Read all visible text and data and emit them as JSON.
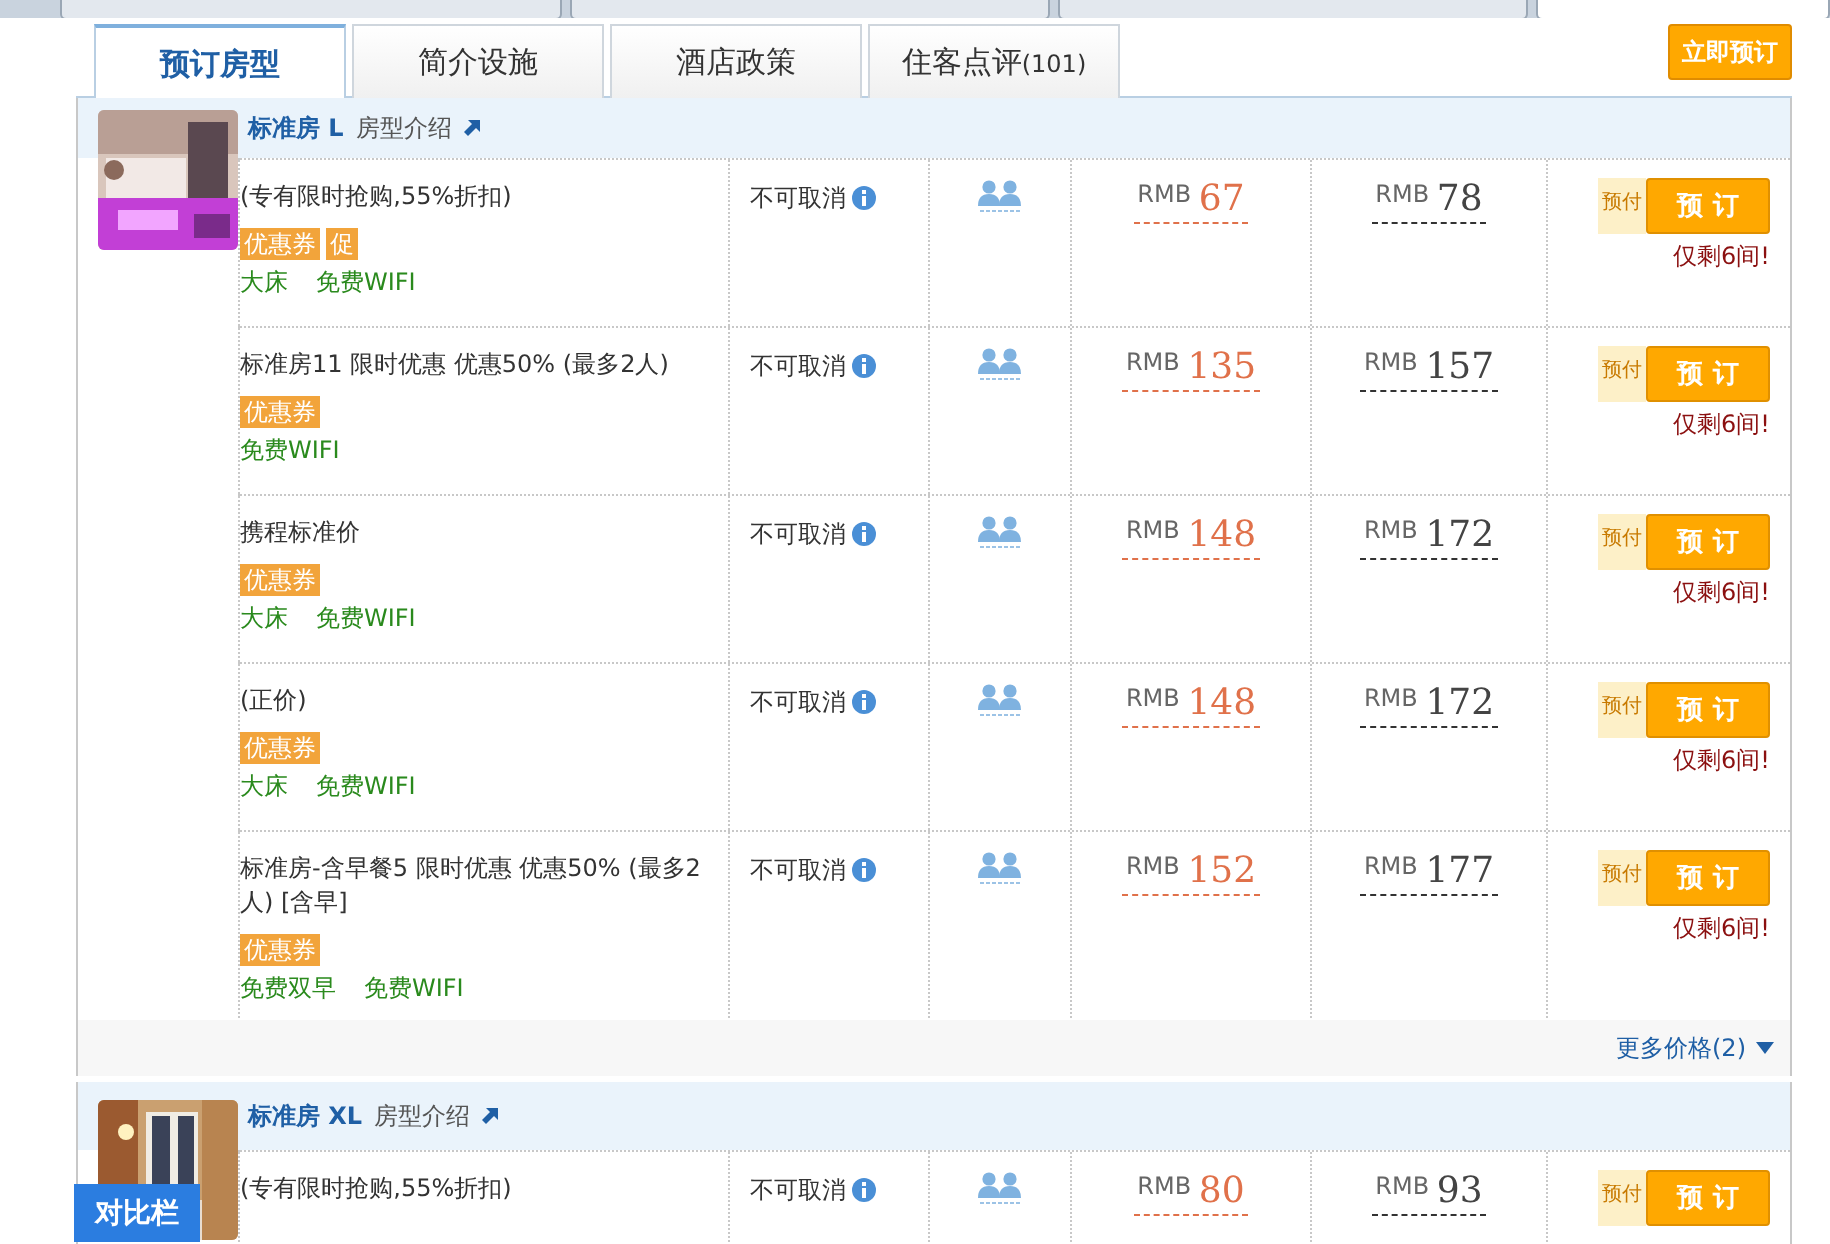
{
  "browser_tabs": [
    {
      "selected": false
    },
    {
      "selected": false
    },
    {
      "selected": false
    },
    {
      "selected": true
    }
  ],
  "tabs": [
    {
      "label": "预订房型",
      "selected": true
    },
    {
      "label": "简介设施",
      "selected": false
    },
    {
      "label": "酒店政策",
      "selected": false
    },
    {
      "label": "住客点评",
      "count": "(101)",
      "selected": false
    }
  ],
  "book_now": "立即预订",
  "rooms": [
    {
      "name": "标准房 L",
      "intro_link": "房型介绍",
      "image": {
        "kind": "picture"
      },
      "more_prices": "更多价格(2)",
      "rates": [
        {
          "description": "(专有限时抢购,55%折扣)",
          "tags": [
            "优惠券",
            "促"
          ],
          "features": [
            "大床",
            "免费WIFI"
          ],
          "cancel_policy": "不可取消",
          "price": {
            "currency": "RMB",
            "amount": "67"
          },
          "original_price": {
            "currency": "RMB",
            "amount": "78"
          },
          "prepay": "预付",
          "book": "预 订",
          "remaining": "仅剩6间!"
        },
        {
          "description": "标准房11 限时优惠 优惠50% (最多2人)",
          "tags": [
            "优惠券"
          ],
          "features": [
            "免费WIFI"
          ],
          "cancel_policy": "不可取消",
          "price": {
            "currency": "RMB",
            "amount": "135"
          },
          "original_price": {
            "currency": "RMB",
            "amount": "157"
          },
          "prepay": "预付",
          "book": "预 订",
          "remaining": "仅剩6间!"
        },
        {
          "description": "携程标准价",
          "tags": [
            "优惠券"
          ],
          "features": [
            "大床",
            "免费WIFI"
          ],
          "cancel_policy": "不可取消",
          "price": {
            "currency": "RMB",
            "amount": "148"
          },
          "original_price": {
            "currency": "RMB",
            "amount": "172"
          },
          "prepay": "预付",
          "book": "预 订",
          "remaining": "仅剩6间!"
        },
        {
          "description": "(正价)",
          "tags": [
            "优惠券"
          ],
          "features": [
            "大床",
            "免费WIFI"
          ],
          "cancel_policy": "不可取消",
          "price": {
            "currency": "RMB",
            "amount": "148"
          },
          "original_price": {
            "currency": "RMB",
            "amount": "172"
          },
          "prepay": "预付",
          "book": "预 订",
          "remaining": "仅剩6间!"
        },
        {
          "description": "标准房-含早餐5 限时优惠 优惠50% (最多2人) [含早]",
          "tags": [
            "优惠券"
          ],
          "features": [
            "免费双早",
            "免费WIFI"
          ],
          "cancel_policy": "不可取消",
          "price": {
            "currency": "RMB",
            "amount": "152"
          },
          "original_price": {
            "currency": "RMB",
            "amount": "177"
          },
          "prepay": "预付",
          "book": "预 订",
          "remaining": "仅剩6间!"
        }
      ]
    },
    {
      "name": "标准房 XL",
      "intro_link": "房型介绍",
      "image": {
        "kind": "picture"
      },
      "rates": [
        {
          "description": "(专有限时抢购,55%折扣)",
          "cancel_policy": "不可取消",
          "price": {
            "currency": "RMB",
            "amount": "80"
          },
          "original_price": {
            "currency": "RMB",
            "amount": "93"
          },
          "prepay": "预付",
          "book": "预 订"
        }
      ]
    }
  ],
  "compare_button": "对比栏"
}
